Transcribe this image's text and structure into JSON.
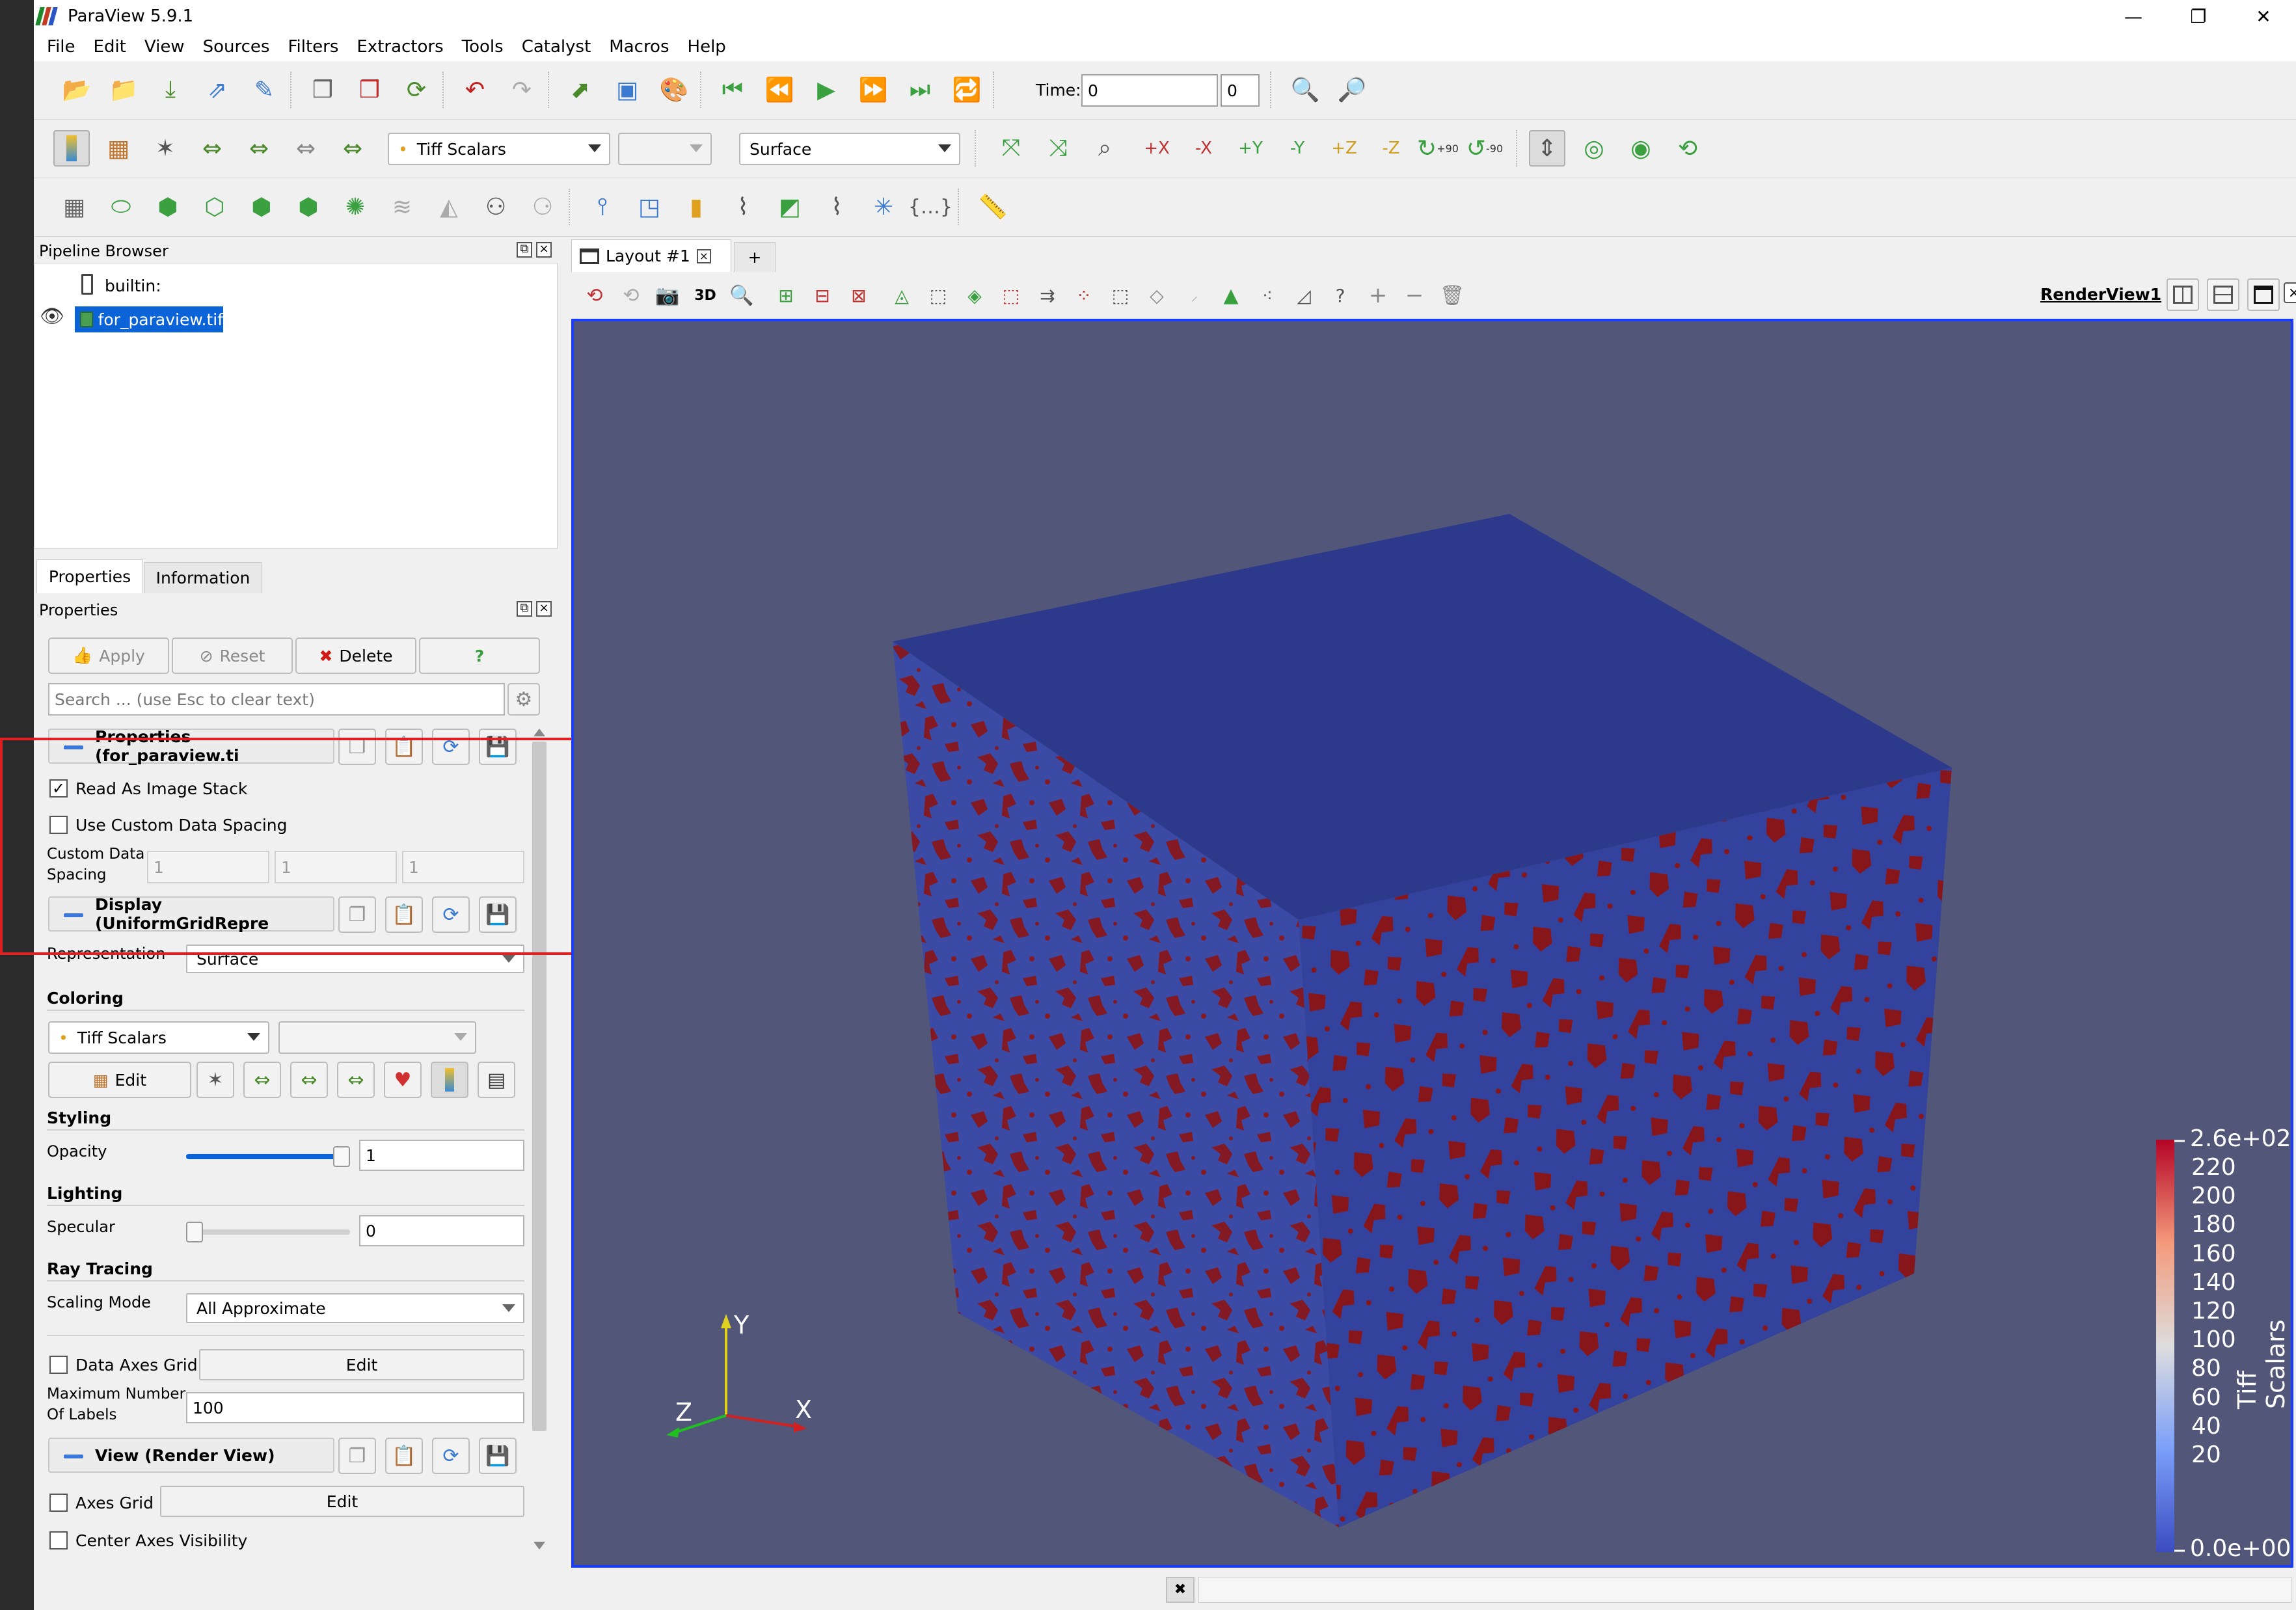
{
  "window": {
    "title": "ParaView 5.9.1",
    "controls": [
      "—",
      "❐",
      "✕"
    ]
  },
  "menu": [
    "File",
    "Edit",
    "View",
    "Sources",
    "Filters",
    "Extractors",
    "Tools",
    "Catalyst",
    "Macros",
    "Help"
  ],
  "toolbar": {
    "time_label": "Time:",
    "time_value": "0",
    "time_index": "0",
    "color_array": "Tiff Scalars",
    "component": "",
    "representation": "Surface",
    "rotate_plus90": "+90",
    "rotate_minus90": "-90",
    "mode_3d": "3D"
  },
  "pipeline": {
    "title": "Pipeline Browser",
    "items": [
      {
        "label": "builtin:"
      },
      {
        "label": "for_paraview.tif"
      }
    ]
  },
  "tabs": {
    "properties": "Properties",
    "information": "Information"
  },
  "properties": {
    "panel_title": "Properties",
    "apply": "Apply",
    "reset": "Reset",
    "delete": "Delete",
    "help": "?",
    "search_placeholder": "Search ... (use Esc to clear text)",
    "section_reader": "Properties (for_paraview.ti",
    "read_as_stack": "Read As Image Stack",
    "read_as_stack_checked": true,
    "use_custom_spacing": "Use Custom Data Spacing",
    "use_custom_spacing_checked": false,
    "custom_spacing_label_1": "Custom Data",
    "custom_spacing_label_2": "Spacing",
    "spacing": [
      "1",
      "1",
      "1"
    ],
    "section_display": "Display (UniformGridRepre",
    "representation_label": "Representation",
    "representation_value": "Surface",
    "coloring_title": "Coloring",
    "coloring_array": "Tiff Scalars",
    "coloring_component": "",
    "edit": "Edit",
    "styling_title": "Styling",
    "opacity_label": "Opacity",
    "opacity_value": "1",
    "opacity_fraction": 1.0,
    "lighting_title": "Lighting",
    "specular_label": "Specular",
    "specular_value": "0",
    "specular_fraction": 0.0,
    "raytracing_title": "Ray Tracing",
    "scaling_mode_label": "Scaling Mode",
    "scaling_mode_value": "All Approximate",
    "data_axes_grid": "Data Axes Grid",
    "data_axes_edit": "Edit",
    "max_labels_1": "Maximum Number",
    "max_labels_2": "Of Labels",
    "max_labels_value": "100",
    "section_view": "View (Render View)",
    "axes_grid": "Axes Grid",
    "axes_grid_edit": "Edit",
    "center_axes": "Center Axes Visibility"
  },
  "layout": {
    "tab_label": "Layout #1",
    "add_tab": "+",
    "view_name": "RenderView1"
  },
  "render": {
    "background": "#52577a",
    "top_face": "#2d3a8c",
    "front_face": "#3a4aa5",
    "right_face": "#33429c",
    "pore_color": "#8b1414",
    "axes": {
      "x": "X",
      "y": "Y",
      "z": "Z"
    }
  },
  "colorbar": {
    "title": "Tiff Scalars",
    "max_label": "2.6e+02",
    "min_label": "0.0e+00",
    "ticks": [
      "220",
      "200",
      "180",
      "160",
      "140",
      "120",
      "100",
      "80",
      "60",
      "40",
      "20"
    ]
  },
  "colors": {
    "accent_blue": "#3c78d8",
    "selection_blue": "#0a64d8",
    "highlight_red": "#e02020",
    "view_border": "#1a3cff"
  }
}
